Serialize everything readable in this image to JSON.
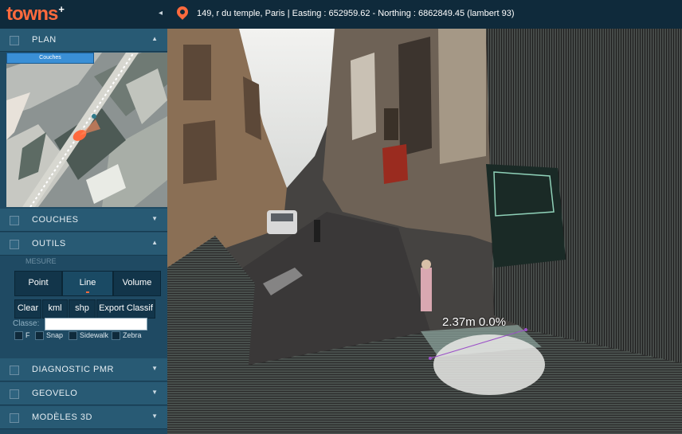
{
  "app": {
    "brand": "towns",
    "brand_plus": "+"
  },
  "header": {
    "location": "149, r du temple, Paris | Easting : 652959.62 - Northing : 6862849.45 (lambert 93)"
  },
  "sidebar": {
    "plan": {
      "title": "PLAN",
      "badge": "Couches"
    },
    "couches": {
      "title": "COUCHES"
    },
    "outils": {
      "title": "OUTILS",
      "mesure_label": "MESURE",
      "tools": [
        "Point",
        "Line",
        "Volume"
      ],
      "active_tool": "Line",
      "actions": [
        "Clear",
        "kml",
        "shp",
        "Export Classif"
      ],
      "classe_label": "Classe:",
      "classe_value": "",
      "checkboxes": [
        "F",
        "Snap",
        "Sidewalk",
        "Zebra"
      ]
    },
    "diagnostic": {
      "title": "DIAGNOSTIC PMR"
    },
    "geovelo": {
      "title": "GEOVELO"
    },
    "modeles": {
      "title": "MODÈLES 3D"
    }
  },
  "measurement": {
    "text": "2.37m  0.0%"
  },
  "colors": {
    "accent": "#ff6a3d",
    "topbar": "#0f2a3b",
    "sidebar": "#1f4a63"
  }
}
